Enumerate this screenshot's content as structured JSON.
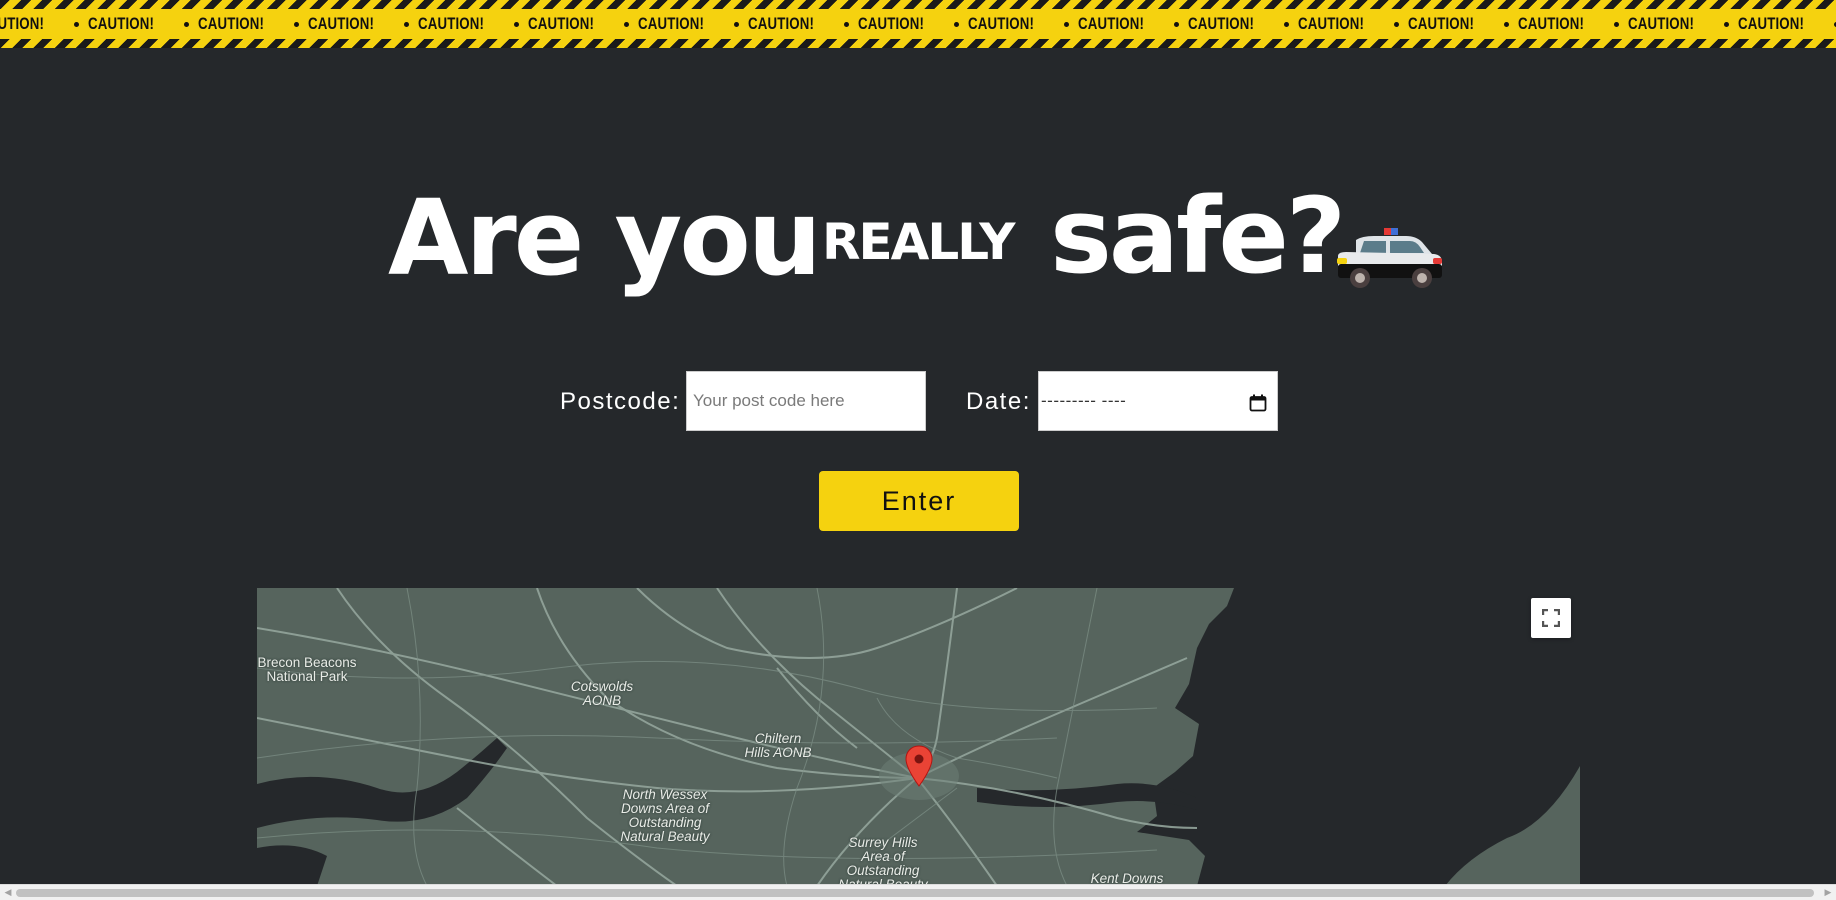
{
  "tape": {
    "word": "CAUTION!",
    "colors": {
      "tape": "#f5d20f",
      "stripe": "#1a1a1a"
    }
  },
  "headline": {
    "part1": "Are you",
    "part2": "REALLY",
    "part3": "safe?",
    "emoji_icon": "police-car-icon"
  },
  "form": {
    "postcode_label": "Postcode:",
    "postcode_placeholder": "Your post code here",
    "date_label": "Date:",
    "date_value": "--------- ----",
    "enter_label": "Enter"
  },
  "map": {
    "labels": [
      "Brecon Beacons National Park",
      "Cotswolds AONB",
      "Chiltern Hills AONB",
      "North Wessex Downs Area of Outstanding Natural Beauty",
      "Surrey Hills Area of Outstanding Natural Beauty",
      "Kent Downs"
    ],
    "fullscreen_icon": "fullscreen-icon",
    "pin_icon": "map-pin-icon"
  },
  "colors": {
    "background": "#25282b",
    "accent": "#f5d20f",
    "land": "#56645d",
    "roads": "#8fa39a"
  }
}
